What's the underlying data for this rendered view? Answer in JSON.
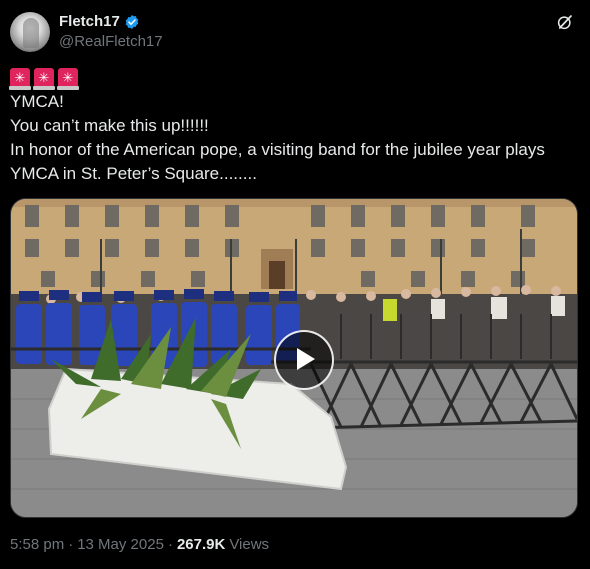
{
  "author": {
    "name": "Fletch17",
    "handle": "@RealFletch17",
    "verified_color": "#1d9bf0"
  },
  "icons": {
    "avatar": "avatar-photo",
    "verified": "verified-badge-icon",
    "grok": "grok-icon",
    "emoji": "rotating-light-emoji",
    "play": "play-icon"
  },
  "tweet": {
    "emoji_count": 3,
    "lines": [
      "YMCA!",
      "You can’t make this up!!!!!!",
      "In honor of the American pope, a visiting band for the jubilee year plays",
      "YMCA in St. Peter’s Square........"
    ]
  },
  "meta": {
    "time": "5:58 pm",
    "separator": "·",
    "date": "13 May 2025",
    "views_count": "267.9K",
    "views_label": "Views"
  },
  "colors": {
    "background": "#000000",
    "text": "#e7e9ea",
    "muted": "#71767b",
    "band_uniform": "#2a46b8"
  }
}
